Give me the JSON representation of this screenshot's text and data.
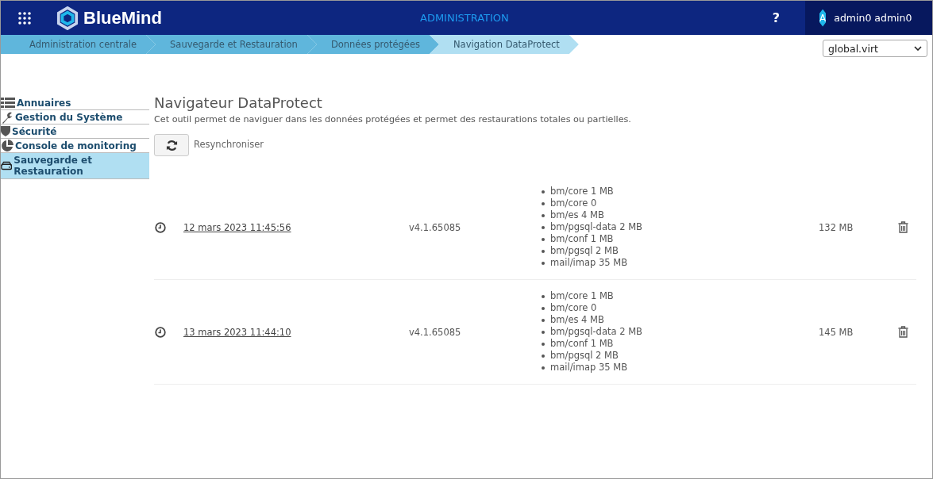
{
  "header": {
    "app_name": "BlueMind",
    "section": "ADMINISTRATION",
    "help": "?",
    "avatar": "A",
    "user": "admin0 admin0"
  },
  "breadcrumbs": [
    {
      "label": "Administration centrale",
      "selected": false
    },
    {
      "label": "Sauvegarde et Restauration",
      "selected": false
    },
    {
      "label": "Données protégées",
      "selected": false
    },
    {
      "label": "Navigation DataProtect",
      "selected": true
    }
  ],
  "domain_select": {
    "value": "global.virt"
  },
  "sidebar": {
    "items": [
      {
        "label": "Annuaires",
        "kind": "list",
        "selected": false
      },
      {
        "label": "Gestion du Système",
        "kind": "wrench",
        "selected": false
      },
      {
        "label": "Sécurité",
        "kind": "shield",
        "selected": false
      },
      {
        "label": "Console de monitoring",
        "kind": "pie",
        "selected": false
      },
      {
        "label": "Sauvegarde et Restauration",
        "kind": "drive",
        "selected": true
      }
    ]
  },
  "page": {
    "title": "Navigateur DataProtect",
    "description": "Cet outil permet de naviguer dans les données protégées et permet des restaurations totales ou partielles.",
    "resync_label": "Resynchroniser"
  },
  "backups": [
    {
      "date": "12 mars 2023 11:45:56",
      "version": "v4.1.65085",
      "parts": [
        "bm/core 1 MB",
        "bm/core 0",
        "bm/es 4 MB",
        "bm/pgsql-data 2 MB",
        "bm/conf 1 MB",
        "bm/pgsql 2 MB",
        "mail/imap 35 MB"
      ],
      "size": "132 MB"
    },
    {
      "date": "13 mars 2023 11:44:10",
      "version": "v4.1.65085",
      "parts": [
        "bm/core 1 MB",
        "bm/core 0",
        "bm/es 4 MB",
        "bm/pgsql-data 2 MB",
        "bm/conf 1 MB",
        "bm/pgsql 2 MB",
        "mail/imap 35 MB"
      ],
      "size": "145 MB"
    }
  ]
}
